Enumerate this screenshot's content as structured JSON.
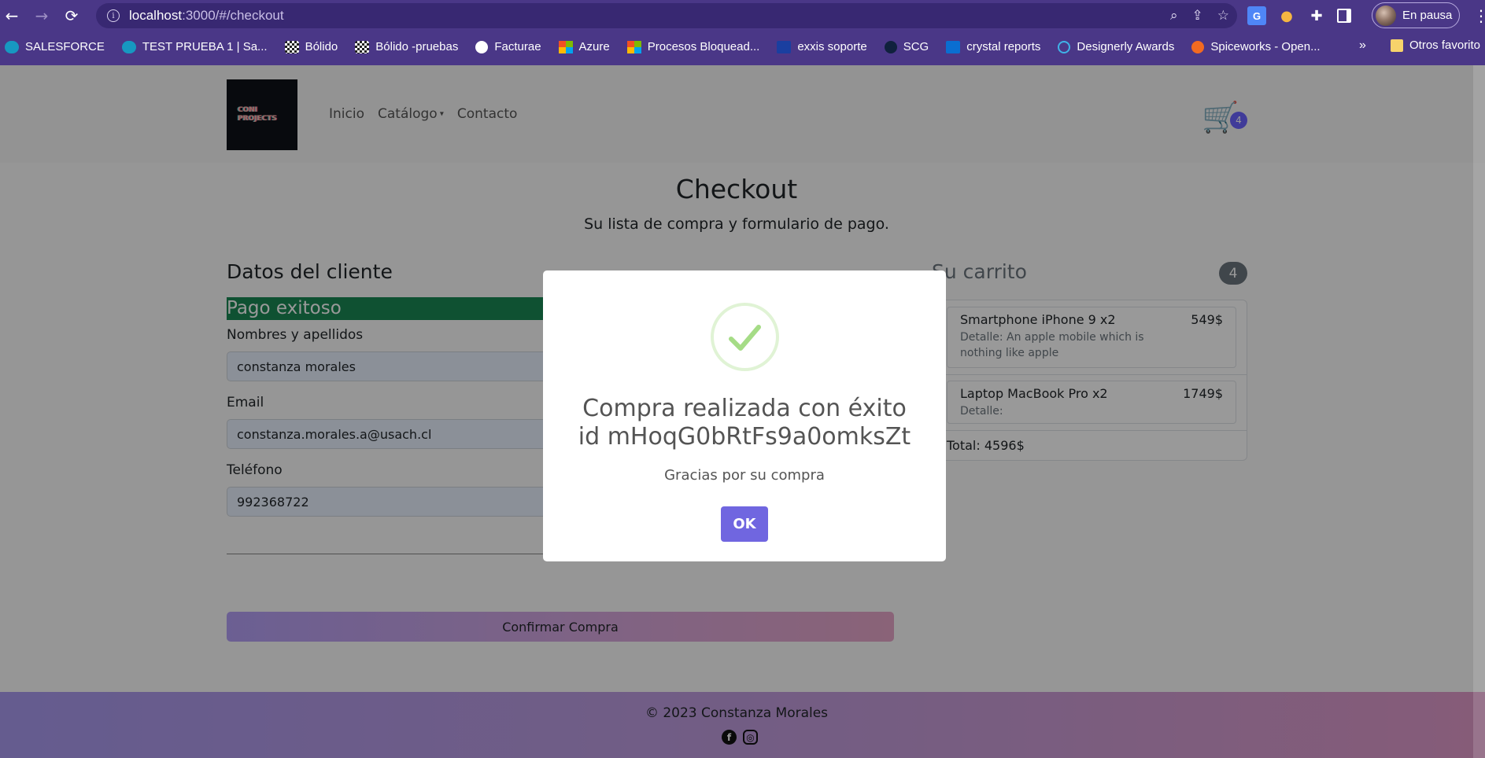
{
  "browser": {
    "url_host": "localhost",
    "url_path": ":3000/#/checkout",
    "profile_label": "En pausa",
    "translate_ext": "G",
    "bookmarks": [
      {
        "label": "SALESFORCE",
        "icon": "salesforce-icon"
      },
      {
        "label": "TEST PRUEBA 1 | Sa...",
        "icon": "salesforce-icon"
      },
      {
        "label": "Bólido",
        "icon": "checkered-flag-icon"
      },
      {
        "label": "Bólido -pruebas",
        "icon": "checkered-flag-icon"
      },
      {
        "label": "Facturae",
        "icon": "facturae-icon"
      },
      {
        "label": "Azure",
        "icon": "microsoft-icon"
      },
      {
        "label": "Procesos Bloquead...",
        "icon": "microsoft-icon"
      },
      {
        "label": "exxis soporte",
        "icon": "exxis-icon"
      },
      {
        "label": "SCG",
        "icon": "scg-icon"
      },
      {
        "label": "crystal reports",
        "icon": "sap-icon"
      },
      {
        "label": "Designerly Awards",
        "icon": "designerly-icon"
      },
      {
        "label": "Spiceworks - Open...",
        "icon": "spiceworks-icon"
      }
    ],
    "more_label": "»",
    "other_bookmarks": "Otros favorito"
  },
  "site": {
    "logo_line1": "CONI",
    "logo_line2": "PROJECTS",
    "nav": {
      "home": "Inicio",
      "catalog": "Catálogo",
      "contact": "Contacto"
    },
    "cart_count": "4"
  },
  "checkout": {
    "title": "Checkout",
    "subtitle": "Su lista de compra y formulario de pago.",
    "client_title": "Datos del cliente",
    "success_msg": "Pago exitoso",
    "fields": {
      "name_label": "Nombres y apellidos",
      "name_value": "constanza morales",
      "email_label": "Email",
      "email_value": "constanza.morales.a@usach.cl",
      "phone_label": "Teléfono",
      "phone_value": "992368722"
    },
    "confirm_button": "Confirmar Compra"
  },
  "cart": {
    "title": "Su carrito",
    "count": "4",
    "items": [
      {
        "name": "Smartphone iPhone 9 x2",
        "price": "549$",
        "detail": "Detalle: An apple mobile which is nothing like apple"
      },
      {
        "name": "Laptop MacBook Pro x2",
        "price": "1749$",
        "detail": "Detalle:"
      }
    ],
    "total": "Total: 4596$"
  },
  "footer": {
    "copyright": "© 2023 Constanza Morales",
    "facebook_glyph": "f"
  },
  "modal": {
    "title_line1": "Compra realizada con éxito",
    "title_line2": "id mHoqG0bRtFs9a0omksZt",
    "text": "Gracias por su compra",
    "ok": "OK",
    "check_color": "#a5dc86"
  }
}
